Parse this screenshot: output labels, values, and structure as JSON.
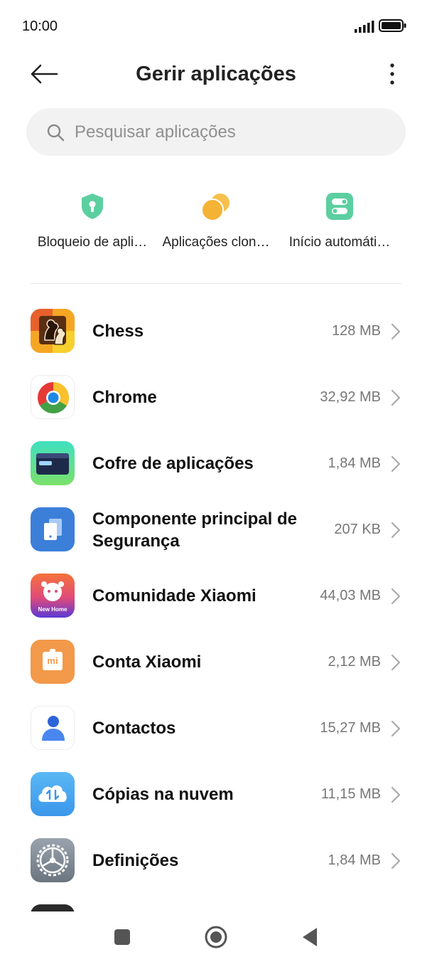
{
  "status_bar": {
    "time": "10:00"
  },
  "header": {
    "title": "Gerir aplicações",
    "back_icon": "arrow-left-icon",
    "more_icon": "vertical-dots-icon"
  },
  "search": {
    "placeholder": "Pesquisar aplicações",
    "value": ""
  },
  "shortcuts": [
    {
      "label": "Bloqueio de apli…",
      "icon": "shield-lock-icon",
      "color": "#5ccfa0"
    },
    {
      "label": "Aplicações clon…",
      "icon": "clone-circles-icon",
      "color": "#f5b335"
    },
    {
      "label": "Início automáti…",
      "icon": "toggle-switch-icon",
      "color": "#5ccfa0"
    }
  ],
  "apps": [
    {
      "name": "Chess",
      "size": "128 MB",
      "icon": "chess-app-icon"
    },
    {
      "name": "Chrome",
      "size": "32,92 MB",
      "icon": "chrome-app-icon"
    },
    {
      "name": "Cofre de aplicações",
      "size": "1,84 MB",
      "icon": "app-vault-icon"
    },
    {
      "name": "Componente principal de Segurança",
      "size": "207 KB",
      "icon": "security-core-icon"
    },
    {
      "name": "Comunidade Xiaomi",
      "size": "44,03 MB",
      "icon": "xiaomi-community-icon",
      "icon_text": "New Home"
    },
    {
      "name": "Conta Xiaomi",
      "size": "2,12 MB",
      "icon": "xiaomi-account-icon",
      "icon_text": "mi"
    },
    {
      "name": "Contactos",
      "size": "15,27 MB",
      "icon": "contacts-app-icon"
    },
    {
      "name": "Cópias na nuvem",
      "size": "11,15 MB",
      "icon": "cloud-backup-icon"
    },
    {
      "name": "Definições",
      "size": "1,84 MB",
      "icon": "settings-app-icon"
    }
  ],
  "nav_bar": {
    "recents_icon": "square-icon",
    "home_icon": "circle-home-icon",
    "back_icon": "triangle-back-icon"
  }
}
